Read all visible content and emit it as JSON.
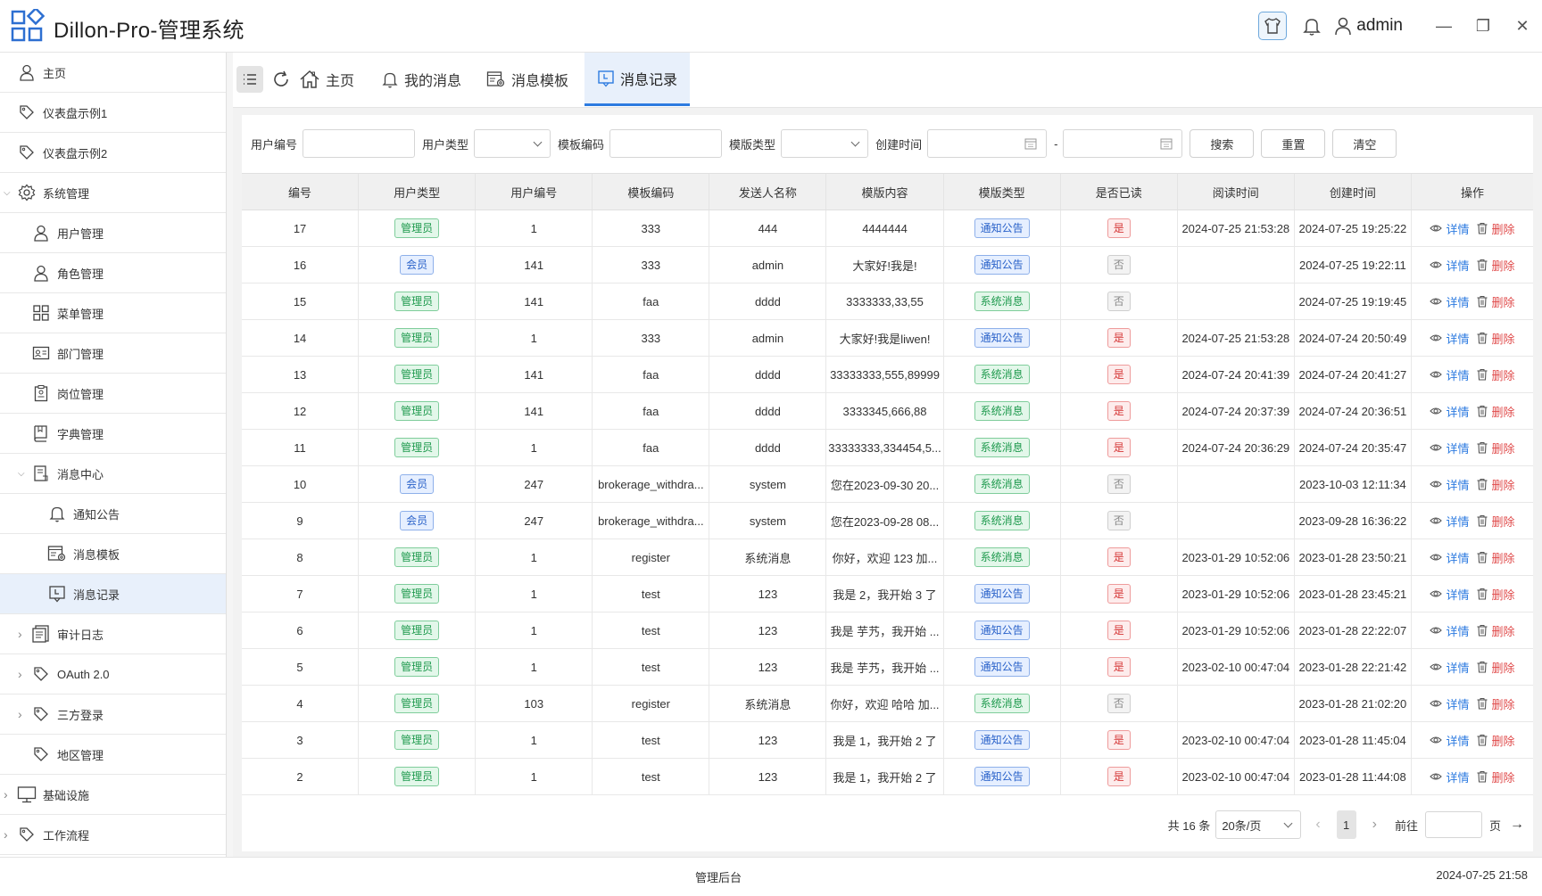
{
  "app": {
    "title": "Dillon-Pro-管理系统",
    "username": "admin",
    "minimize": "—",
    "restore": "❐",
    "close": "✕"
  },
  "sidebar": {
    "items": [
      {
        "label": "主页",
        "icon": "user-icon"
      },
      {
        "label": "仪表盘示例1",
        "icon": "tag-icon"
      },
      {
        "label": "仪表盘示例2",
        "icon": "tag-icon"
      },
      {
        "label": "系统管理",
        "icon": "gear-icon",
        "expanded": true
      },
      {
        "label": "用户管理",
        "icon": "user-icon"
      },
      {
        "label": "角色管理",
        "icon": "user-icon"
      },
      {
        "label": "菜单管理",
        "icon": "grid-icon"
      },
      {
        "label": "部门管理",
        "icon": "id-card-icon"
      },
      {
        "label": "岗位管理",
        "icon": "clipboard-icon"
      },
      {
        "label": "字典管理",
        "icon": "book-icon"
      },
      {
        "label": "消息中心",
        "icon": "document-icon",
        "expanded": true
      },
      {
        "label": "通知公告",
        "icon": "bell-icon"
      },
      {
        "label": "消息模板",
        "icon": "template-icon"
      },
      {
        "label": "消息记录",
        "icon": "message-icon",
        "active": true
      },
      {
        "label": "审计日志",
        "icon": "log-icon"
      },
      {
        "label": "OAuth 2.0",
        "icon": "tag-icon"
      },
      {
        "label": "三方登录",
        "icon": "tag-icon"
      },
      {
        "label": "地区管理",
        "icon": "tag-icon"
      },
      {
        "label": "基础设施",
        "icon": "monitor-icon"
      },
      {
        "label": "工作流程",
        "icon": "tag-icon"
      }
    ]
  },
  "tabs": [
    {
      "label": "主页",
      "icon": "home-icon"
    },
    {
      "label": "我的消息",
      "icon": "bell-icon"
    },
    {
      "label": "消息模板",
      "icon": "template-icon"
    },
    {
      "label": "消息记录",
      "icon": "message-icon",
      "active": true
    }
  ],
  "filters": {
    "user_id_label": "用户编号",
    "user_type_label": "用户类型",
    "template_code_label": "模板编码",
    "template_type_label": "模版类型",
    "created_label": "创建时间",
    "date_sep": "-",
    "search": "搜索",
    "reset": "重置",
    "clear": "清空"
  },
  "table": {
    "columns": [
      "编号",
      "用户类型",
      "用户编号",
      "模板编码",
      "发送人名称",
      "模版内容",
      "模版类型",
      "是否已读",
      "阅读时间",
      "创建时间",
      "操作"
    ],
    "detail_label": "详情",
    "delete_label": "删除",
    "rows": [
      {
        "id": "17",
        "user_type": "管理员",
        "user_id": "1",
        "code": "333",
        "sender": "444",
        "content": "4444444",
        "type": "通知公告",
        "read": "是",
        "read_time": "2024-07-25 21:53:28",
        "created": "2024-07-25 19:25:22"
      },
      {
        "id": "16",
        "user_type": "会员",
        "user_id": "141",
        "code": "333",
        "sender": "admin",
        "content": "大家好!我是!",
        "type": "通知公告",
        "read": "否",
        "read_time": "",
        "created": "2024-07-25 19:22:11"
      },
      {
        "id": "15",
        "user_type": "管理员",
        "user_id": "141",
        "code": "faa",
        "sender": "dddd",
        "content": "3333333,33,55",
        "type": "系统消息",
        "read": "否",
        "read_time": "",
        "created": "2024-07-25 19:19:45"
      },
      {
        "id": "14",
        "user_type": "管理员",
        "user_id": "1",
        "code": "333",
        "sender": "admin",
        "content": "大家好!我是liwen!",
        "type": "通知公告",
        "read": "是",
        "read_time": "2024-07-25 21:53:28",
        "created": "2024-07-24 20:50:49"
      },
      {
        "id": "13",
        "user_type": "管理员",
        "user_id": "141",
        "code": "faa",
        "sender": "dddd",
        "content": "33333333,555,89999",
        "type": "系统消息",
        "read": "是",
        "read_time": "2024-07-24 20:41:39",
        "created": "2024-07-24 20:41:27"
      },
      {
        "id": "12",
        "user_type": "管理员",
        "user_id": "141",
        "code": "faa",
        "sender": "dddd",
        "content": "3333345,666,88",
        "type": "系统消息",
        "read": "是",
        "read_time": "2024-07-24 20:37:39",
        "created": "2024-07-24 20:36:51"
      },
      {
        "id": "11",
        "user_type": "管理员",
        "user_id": "1",
        "code": "faa",
        "sender": "dddd",
        "content": "33333333,334454,5...",
        "type": "系统消息",
        "read": "是",
        "read_time": "2024-07-24 20:36:29",
        "created": "2024-07-24 20:35:47"
      },
      {
        "id": "10",
        "user_type": "会员",
        "user_id": "247",
        "code": "brokerage_withdra...",
        "sender": "system",
        "content": "您在2023-09-30 20...",
        "type": "系统消息",
        "read": "否",
        "read_time": "",
        "created": "2023-10-03 12:11:34"
      },
      {
        "id": "9",
        "user_type": "会员",
        "user_id": "247",
        "code": "brokerage_withdra...",
        "sender": "system",
        "content": "您在2023-09-28 08...",
        "type": "系统消息",
        "read": "否",
        "read_time": "",
        "created": "2023-09-28 16:36:22"
      },
      {
        "id": "8",
        "user_type": "管理员",
        "user_id": "1",
        "code": "register",
        "sender": "系统消息",
        "content": "你好，欢迎 123 加...",
        "type": "系统消息",
        "read": "是",
        "read_time": "2023-01-29 10:52:06",
        "created": "2023-01-28 23:50:21"
      },
      {
        "id": "7",
        "user_type": "管理员",
        "user_id": "1",
        "code": "test",
        "sender": "123",
        "content": "我是 2，我开始 3 了",
        "type": "通知公告",
        "read": "是",
        "read_time": "2023-01-29 10:52:06",
        "created": "2023-01-28 23:45:21"
      },
      {
        "id": "6",
        "user_type": "管理员",
        "user_id": "1",
        "code": "test",
        "sender": "123",
        "content": "我是 芋艿，我开始 ...",
        "type": "通知公告",
        "read": "是",
        "read_time": "2023-01-29 10:52:06",
        "created": "2023-01-28 22:22:07"
      },
      {
        "id": "5",
        "user_type": "管理员",
        "user_id": "1",
        "code": "test",
        "sender": "123",
        "content": "我是 芋艿，我开始 ...",
        "type": "通知公告",
        "read": "是",
        "read_time": "2023-02-10 00:47:04",
        "created": "2023-01-28 22:21:42"
      },
      {
        "id": "4",
        "user_type": "管理员",
        "user_id": "103",
        "code": "register",
        "sender": "系统消息",
        "content": "你好，欢迎 哈哈 加...",
        "type": "系统消息",
        "read": "否",
        "read_time": "",
        "created": "2023-01-28 21:02:20"
      },
      {
        "id": "3",
        "user_type": "管理员",
        "user_id": "1",
        "code": "test",
        "sender": "123",
        "content": "我是 1，我开始 2 了",
        "type": "通知公告",
        "read": "是",
        "read_time": "2023-02-10 00:47:04",
        "created": "2023-01-28 11:45:04"
      },
      {
        "id": "2",
        "user_type": "管理员",
        "user_id": "1",
        "code": "test",
        "sender": "123",
        "content": "我是 1，我开始 2 了",
        "type": "通知公告",
        "read": "是",
        "read_time": "2023-02-10 00:47:04",
        "created": "2023-01-28 11:44:08"
      }
    ]
  },
  "pager": {
    "total": "共 16 条",
    "page_size": "20条/页",
    "current": "1",
    "goto": "前往",
    "page_unit": "页"
  },
  "statusbar": {
    "center": "管理后台",
    "right": "2024-07-25 21:58"
  },
  "colors": {
    "accent": "#2d7be0",
    "active_bg": "#e8f0fb",
    "danger": "#e04b4b",
    "success": "#1f9a4e"
  }
}
